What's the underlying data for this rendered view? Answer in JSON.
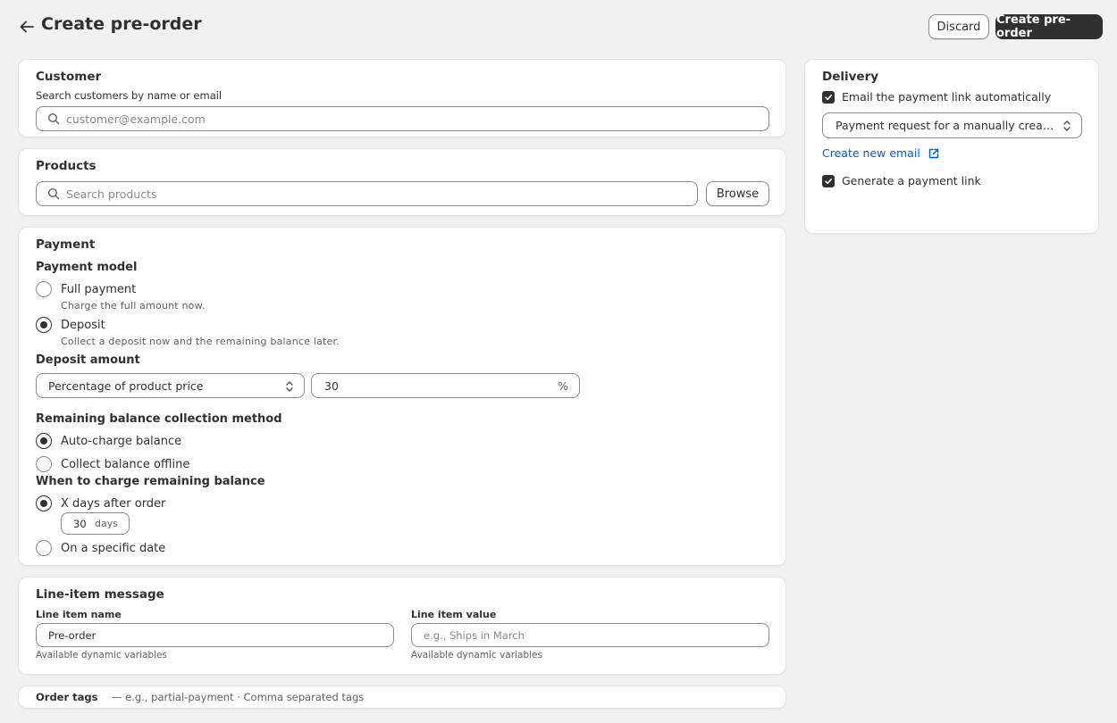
{
  "header": {
    "title": "Create pre-order",
    "discard_label": "Discard",
    "create_label": "Create pre-order"
  },
  "customer": {
    "title": "Customer",
    "search_label": "Search customers by name or email",
    "search_placeholder": "customer@example.com"
  },
  "products": {
    "title": "Products",
    "search_placeholder": "Search products",
    "browse_label": "Browse"
  },
  "payment": {
    "title": "Payment",
    "model_heading": "Payment model",
    "full_payment_label": "Full payment",
    "full_payment_help": "Charge the full amount now.",
    "deposit_label": "Deposit",
    "deposit_help": "Collect a deposit now and the remaining balance later.",
    "deposit_amount_heading": "Deposit amount",
    "deposit_type_value": "Percentage of product price",
    "deposit_value": "30",
    "deposit_suffix": "%",
    "remaining_heading": "Remaining balance collection method",
    "auto_charge_label": "Auto-charge balance",
    "collect_offline_label": "Collect balance offline",
    "when_heading": "When to charge remaining balance",
    "x_days_label": "X days after order",
    "days_value": "30",
    "days_suffix": "days",
    "specific_date_label": "On a specific date"
  },
  "line_item": {
    "title": "Line-item message",
    "name_label": "Line item name",
    "name_value": "Pre-order",
    "name_help": "Available dynamic variables",
    "value_label": "Line item value",
    "value_placeholder": "e.g., Ships in March",
    "value_help": "Available dynamic variables"
  },
  "order_tags": {
    "title": "Order tags",
    "hint": "— e.g., partial-payment · Comma separated tags"
  },
  "delivery": {
    "title": "Delivery",
    "email_auto_label": "Email the payment link automatically",
    "template_value": "Payment request for a manually crea…",
    "create_email_label": "Create new email",
    "generate_link_label": "Generate a payment link"
  }
}
